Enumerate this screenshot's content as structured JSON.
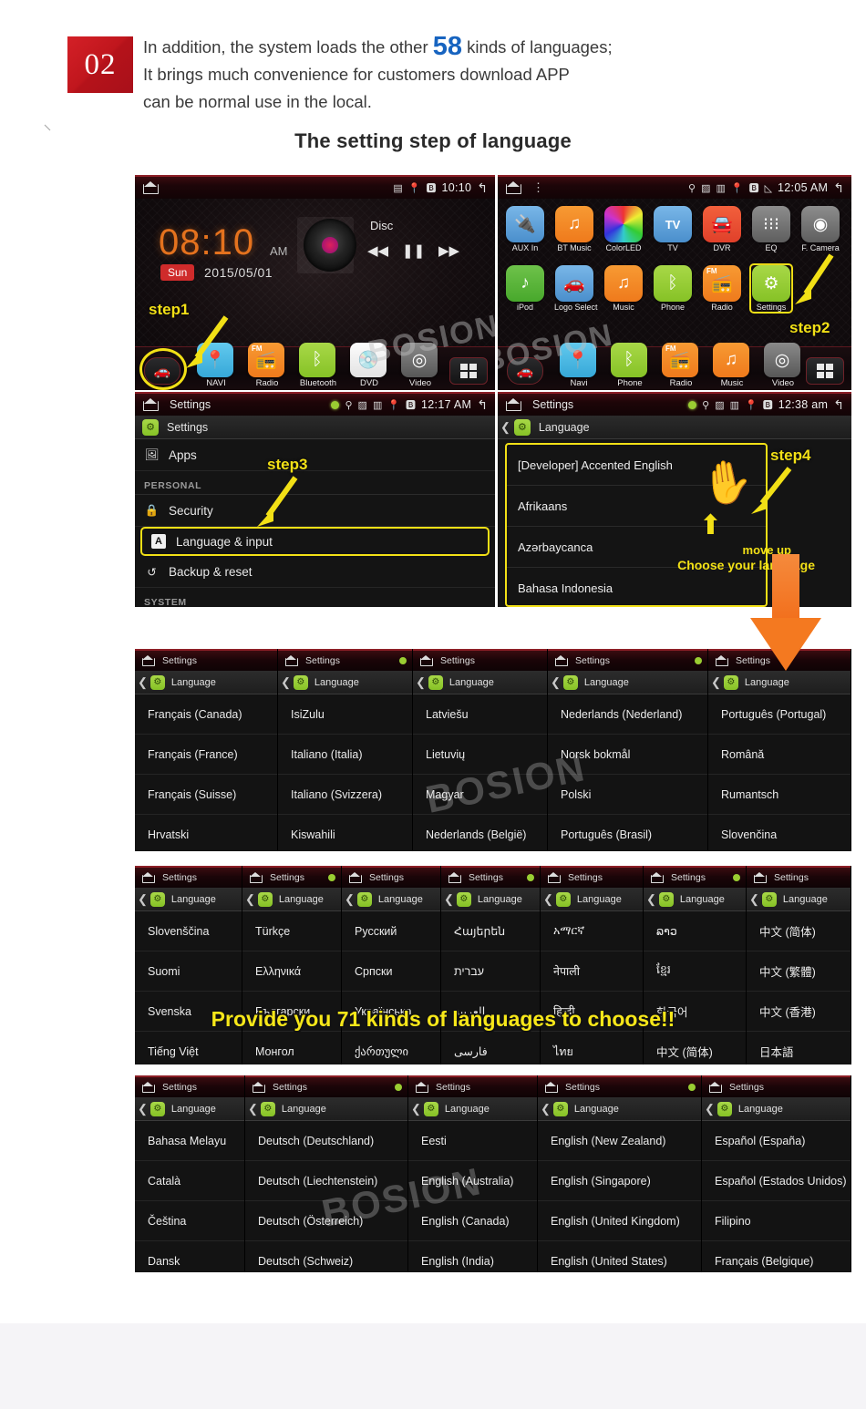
{
  "header": {
    "badge": "02",
    "intro_line1_a": "In addition, the system loads the other ",
    "intro_num": "58",
    "intro_line1_b": " kinds of languages;",
    "intro_line2": "It brings much convenience for customers download APP",
    "intro_line3": "can be normal use in the local.",
    "subtitle": "The setting step of language"
  },
  "steps": {
    "step1": "step1",
    "step2": "step2",
    "step3": "step3",
    "step4": "step4"
  },
  "panel1": {
    "statusbar": {
      "title": "",
      "clock": "10:10",
      "icons": [
        "sd-card-icon",
        "location-icon",
        "bluetooth-icon"
      ],
      "back": "back-icon"
    },
    "clock": "08:10",
    "ampm": "AM",
    "day": "Sun",
    "date": "2015/05/01",
    "media_label": "Disc",
    "controls": [
      "prev-track",
      "pause",
      "next-track"
    ],
    "dock": [
      {
        "label": "NAVI",
        "icon": "location-pin-icon"
      },
      {
        "label": "Radio",
        "icon": "fm-radio-icon"
      },
      {
        "label": "Bluetooth",
        "icon": "bluetooth-icon"
      },
      {
        "label": "DVD",
        "icon": "disc-icon"
      },
      {
        "label": "Video",
        "icon": "video-icon"
      }
    ]
  },
  "panel2": {
    "statusbar": {
      "clock": "12:05 AM",
      "icons": [
        "usb-icon",
        "sd-icon",
        "signal-bars-icon",
        "location-icon",
        "bluetooth-icon",
        "network-icon"
      ]
    },
    "row1": [
      {
        "label": "AUX In",
        "icon": "aux-plug-icon"
      },
      {
        "label": "BT Music",
        "icon": "bt-music-icon"
      },
      {
        "label": "ColorLED",
        "icon": "color-wheel-icon"
      },
      {
        "label": "TV",
        "icon": "tv-icon"
      },
      {
        "label": "DVR",
        "icon": "dvr-car-icon"
      },
      {
        "label": "EQ",
        "icon": "equalizer-icon"
      },
      {
        "label": "F. Camera",
        "icon": "front-camera-icon"
      }
    ],
    "row2": [
      {
        "label": "iPod",
        "icon": "music-note-icon"
      },
      {
        "label": "Logo Select",
        "icon": "car-logo-icon"
      },
      {
        "label": "Music",
        "icon": "music-icon"
      },
      {
        "label": "Phone",
        "icon": "bluetooth-phone-icon"
      },
      {
        "label": "Radio",
        "icon": "fm-radio-icon"
      },
      {
        "label": "Settings",
        "icon": "gear-icon"
      }
    ],
    "dock": [
      {
        "label": "Navi",
        "icon": "location-pin-icon"
      },
      {
        "label": "Phone",
        "icon": "bluetooth-phone-icon"
      },
      {
        "label": "Radio",
        "icon": "fm-radio-icon"
      },
      {
        "label": "Music",
        "icon": "music-icon"
      },
      {
        "label": "Video",
        "icon": "video-icon"
      }
    ]
  },
  "panel3": {
    "statusbar": {
      "title": "Settings",
      "clock": "12:17 AM"
    },
    "header": "Settings",
    "rows": [
      {
        "label": "Apps",
        "icon": "apps-icon",
        "type": "item"
      },
      {
        "label": "PERSONAL",
        "type": "category"
      },
      {
        "label": "Security",
        "icon": "lock-icon",
        "type": "item"
      },
      {
        "label": "Language & input",
        "icon": "language-a-icon",
        "type": "item",
        "highlight": true
      },
      {
        "label": "Backup & reset",
        "icon": "backup-icon",
        "type": "item"
      },
      {
        "label": "SYSTEM",
        "type": "category"
      }
    ]
  },
  "panel4": {
    "statusbar": {
      "title": "Settings",
      "clock": "12:38 am"
    },
    "header": "Language",
    "items": [
      "[Developer] Accented English",
      "Afrikaans",
      "Azərbaycanca",
      "Bahasa Indonesia"
    ],
    "hint_move_up": "move up",
    "hint_choose": "Choose your language"
  },
  "grid_common": {
    "statusbar_title": "Settings",
    "header": "Language"
  },
  "grid_rows": [
    {
      "columns": [
        {
          "items": [
            "Français (Canada)",
            "Français (France)",
            "Français (Suisse)",
            "Hrvatski"
          ]
        },
        {
          "items": [
            "IsiZulu",
            "Italiano (Italia)",
            "Italiano (Svizzera)",
            "Kiswahili"
          ]
        },
        {
          "items": [
            "Latviešu",
            "Lietuvių",
            "Magyar",
            "Nederlands (België)"
          ]
        },
        {
          "items": [
            "Nederlands (Nederland)",
            "Norsk bokmål",
            "Polski",
            "Português (Brasil)"
          ]
        },
        {
          "items": [
            "Português (Portugal)",
            "Română",
            "Rumantsch",
            "Slovenčina"
          ]
        }
      ]
    },
    {
      "columns": [
        {
          "items": [
            "Slovenščina",
            "Suomi",
            "Svenska",
            "Tiếng Việt"
          ]
        },
        {
          "items": [
            "Türkçe",
            "Ελληνικά",
            "Български",
            "Монгол"
          ]
        },
        {
          "items": [
            "Русский",
            "Српски",
            "Українська",
            "ქართული"
          ]
        },
        {
          "items": [
            "Հայերեն",
            "עברית",
            "العربية",
            "فارسی"
          ]
        },
        {
          "items": [
            "አማርኛ",
            "नेपाली",
            "हिन्दी",
            "ไทย"
          ]
        },
        {
          "items": [
            "ລາວ",
            "ខ្មែរ",
            "한국어",
            "中文 (简体)"
          ]
        },
        {
          "items": [
            "中文 (简体)",
            "中文 (繁體)",
            "中文 (香港)",
            "日本語"
          ]
        }
      ]
    },
    {
      "columns": [
        {
          "items": [
            "Bahasa Melayu",
            "Català",
            "Čeština",
            "Dansk"
          ]
        },
        {
          "items": [
            "Deutsch (Deutschland)",
            "Deutsch (Liechtenstein)",
            "Deutsch (Österreich)",
            "Deutsch (Schweiz)"
          ]
        },
        {
          "items": [
            "Eesti",
            "English (Australia)",
            "English (Canada)",
            "English (India)"
          ]
        },
        {
          "items": [
            "English (New Zealand)",
            "English (Singapore)",
            "English (United Kingdom)",
            "English (United States)"
          ]
        },
        {
          "items": [
            "Español (España)",
            "Español (Estados Unidos)",
            "Filipino",
            "Français (Belgique)"
          ]
        }
      ]
    }
  ],
  "banner": "Provide you 71 kinds of languages to choose!!",
  "watermark": "BOSION",
  "colors": {
    "badge_red": "#c0161d",
    "accent_blue": "#1764c0",
    "highlight_yellow": "#f2e016",
    "banner_yellow": "#f7e719",
    "orange_arrow": "#f47920"
  }
}
